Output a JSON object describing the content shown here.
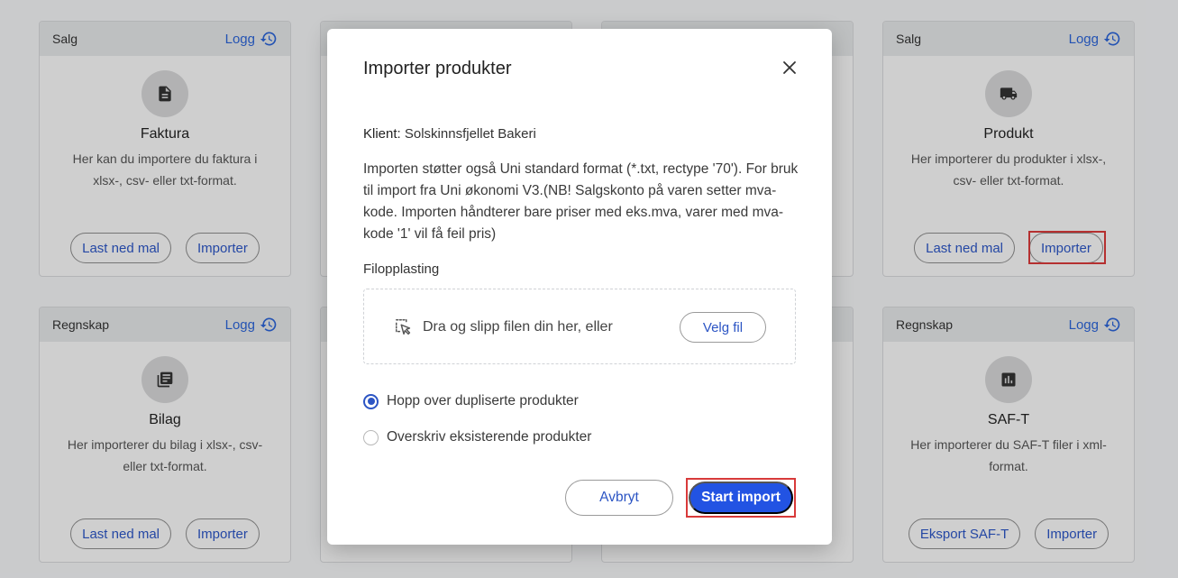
{
  "cards": [
    {
      "category": "Salg",
      "log_label": "Logg",
      "title": "Faktura",
      "desc": "Her kan du importere du faktura i xlsx-, csv- eller txt-format.",
      "buttons": [
        "Last ned mal",
        "Importer"
      ],
      "icon": "document-icon"
    },
    {
      "category": "Salg",
      "log_label": "Logg",
      "title": "Produkt",
      "desc": "Her importerer du produkter i xlsx-, csv- eller txt-format.",
      "buttons": [
        "Last ned mal",
        "Importer"
      ],
      "icon": "truck-icon"
    },
    {
      "category": "Regnskap",
      "log_label": "Logg",
      "title": "Bilag",
      "desc": "Her importerer du bilag i xlsx-, csv- eller txt-format.",
      "buttons": [
        "Last ned mal",
        "Importer"
      ],
      "icon": "library-books-icon"
    },
    {
      "category": "Regnskap",
      "log_label": "Logg",
      "title": "SAF-T",
      "desc": "Her importerer du SAF-T filer i xml-format.",
      "buttons": [
        "Eksport SAF-T",
        "Importer"
      ],
      "icon": "bar-chart-icon"
    }
  ],
  "modal": {
    "title": "Importer produkter",
    "client_label": "Klient:",
    "client_name": "Solskinnsfjellet Bakeri",
    "info": "Importen støtter også Uni standard format (*.txt, rectype '70'). For bruk til import fra Uni økonomi V3.(NB! Salgskonto på varen setter mva-kode. Importen håndterer bare priser med eks.mva, varer med mva-kode '1' vil få feil pris)",
    "upload_label": "Filopplasting",
    "drop_text": "Dra og slipp filen din her, eller",
    "pick_file": "Velg fil",
    "options": [
      {
        "label": "Hopp over dupliserte produkter",
        "selected": true
      },
      {
        "label": "Overskriv eksisterende produkter",
        "selected": false
      }
    ],
    "cancel": "Avbryt",
    "start": "Start import"
  },
  "colors": {
    "accent": "#2253e3",
    "link": "#2c64d6",
    "highlight": "#d83a3a"
  }
}
